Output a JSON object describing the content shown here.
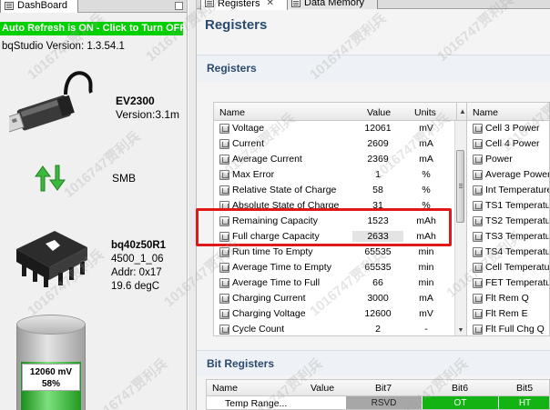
{
  "dashboard": {
    "tab_label": "DashBoard",
    "auto_refresh": "Auto Refresh is ON - Click to Turn OFF",
    "version": "bqStudio Version:  1.3.54.1",
    "adapter": {
      "name": "EV2300",
      "version": "Version:3.1m"
    },
    "bus": "SMB",
    "gauge": {
      "name": "bq40z50R1",
      "firmware": "4500_1_06",
      "address": "Addr: 0x17",
      "temperature": "19.6 degC"
    },
    "battery": {
      "voltage": "12060 mV",
      "percent": "58%",
      "fill_fraction": 0.58,
      "color": "#1d9a1d"
    }
  },
  "tabs": [
    {
      "label": "Registers",
      "active": true
    },
    {
      "label": "Data Memory",
      "active": false
    }
  ],
  "registers": {
    "title": "Registers",
    "section_title": "Registers",
    "columns": {
      "name": "Name",
      "value": "Value",
      "units": "Units"
    },
    "rows": [
      {
        "name": "Voltage",
        "value": "12061",
        "units": "mV"
      },
      {
        "name": "Current",
        "value": "2609",
        "units": "mA"
      },
      {
        "name": "Average Current",
        "value": "2369",
        "units": "mA"
      },
      {
        "name": "Max Error",
        "value": "1",
        "units": "%"
      },
      {
        "name": "Relative State of Charge",
        "value": "58",
        "units": "%"
      },
      {
        "name": "Absolute State of Charge",
        "value": "31",
        "units": "%"
      },
      {
        "name": "Remaining Capacity",
        "value": "1523",
        "units": "mAh"
      },
      {
        "name": "Full charge Capacity",
        "value": "2633",
        "units": "mAh"
      },
      {
        "name": "Run time To Empty",
        "value": "65535",
        "units": "min"
      },
      {
        "name": "Average Time to Empty",
        "value": "65535",
        "units": "min"
      },
      {
        "name": "Average Time to Full",
        "value": "66",
        "units": "min"
      },
      {
        "name": "Charging Current",
        "value": "3000",
        "units": "mA"
      },
      {
        "name": "Charging Voltage",
        "value": "12600",
        "units": "mV"
      },
      {
        "name": "Cycle Count",
        "value": "2",
        "units": "-"
      }
    ],
    "side_columns": {
      "name": "Name"
    },
    "side_rows": [
      "Cell 3 Power",
      "Cell 4 Power",
      "Power",
      "Average Power",
      "Int Temperature",
      "TS1 Temperature",
      "TS2 Temperature",
      "TS3 Temperature",
      "TS4 Temperature",
      "Cell Temperature",
      "FET Temperature",
      "Flt Rem Q",
      "Flt Rem E",
      "Flt Full Chg Q"
    ],
    "highlight_color": "#e01818"
  },
  "bit_registers": {
    "title": "Bit Registers",
    "columns": {
      "name": "Name",
      "value": "Value",
      "bit7": "Bit7",
      "bit6": "Bit6",
      "bit5": "Bit5"
    },
    "row": {
      "name": "Temp Range...",
      "bit7": "RSVD",
      "bit6": "OT",
      "bit5": "HT"
    },
    "colors": {
      "bit_off": "#a7a7a7",
      "bit_on": "#12b312"
    }
  },
  "watermark": "1016747贾利兵"
}
